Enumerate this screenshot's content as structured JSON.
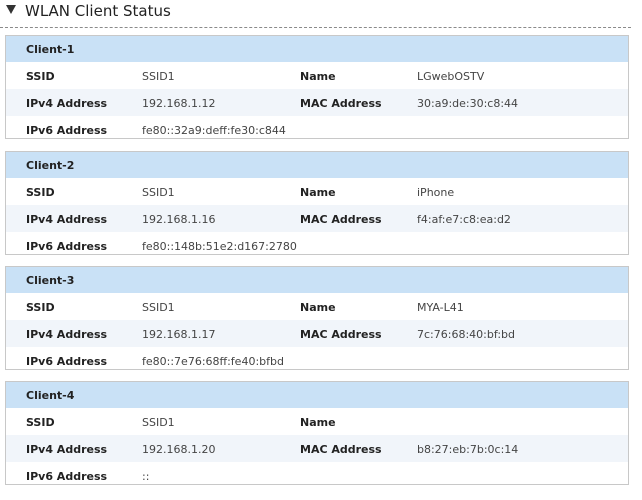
{
  "section": {
    "title": "WLAN Client Status"
  },
  "labels": {
    "ssid": "SSID",
    "name": "Name",
    "ipv4": "IPv4 Address",
    "mac": "MAC Address",
    "ipv6": "IPv6 Address"
  },
  "clients": [
    {
      "title": "Client-1",
      "ssid": "SSID1",
      "name": "LGwebOSTV",
      "ipv4": "192.168.1.12",
      "mac": "30:a9:de:30:c8:44",
      "ipv6": "fe80::32a9:deff:fe30:c844"
    },
    {
      "title": "Client-2",
      "ssid": "SSID1",
      "name": "iPhone",
      "ipv4": "192.168.1.16",
      "mac": "f4:af:e7:c8:ea:d2",
      "ipv6": "fe80::148b:51e2:d167:2780"
    },
    {
      "title": "Client-3",
      "ssid": "SSID1",
      "name": "MYA-L41",
      "ipv4": "192.168.1.17",
      "mac": "7c:76:68:40:bf:bd",
      "ipv6": "fe80::7e76:68ff:fe40:bfbd"
    },
    {
      "title": "Client-4",
      "ssid": "SSID1",
      "name": "",
      "ipv4": "192.168.1.20",
      "mac": "b8:27:eb:7b:0c:14",
      "ipv6": "::"
    }
  ]
}
